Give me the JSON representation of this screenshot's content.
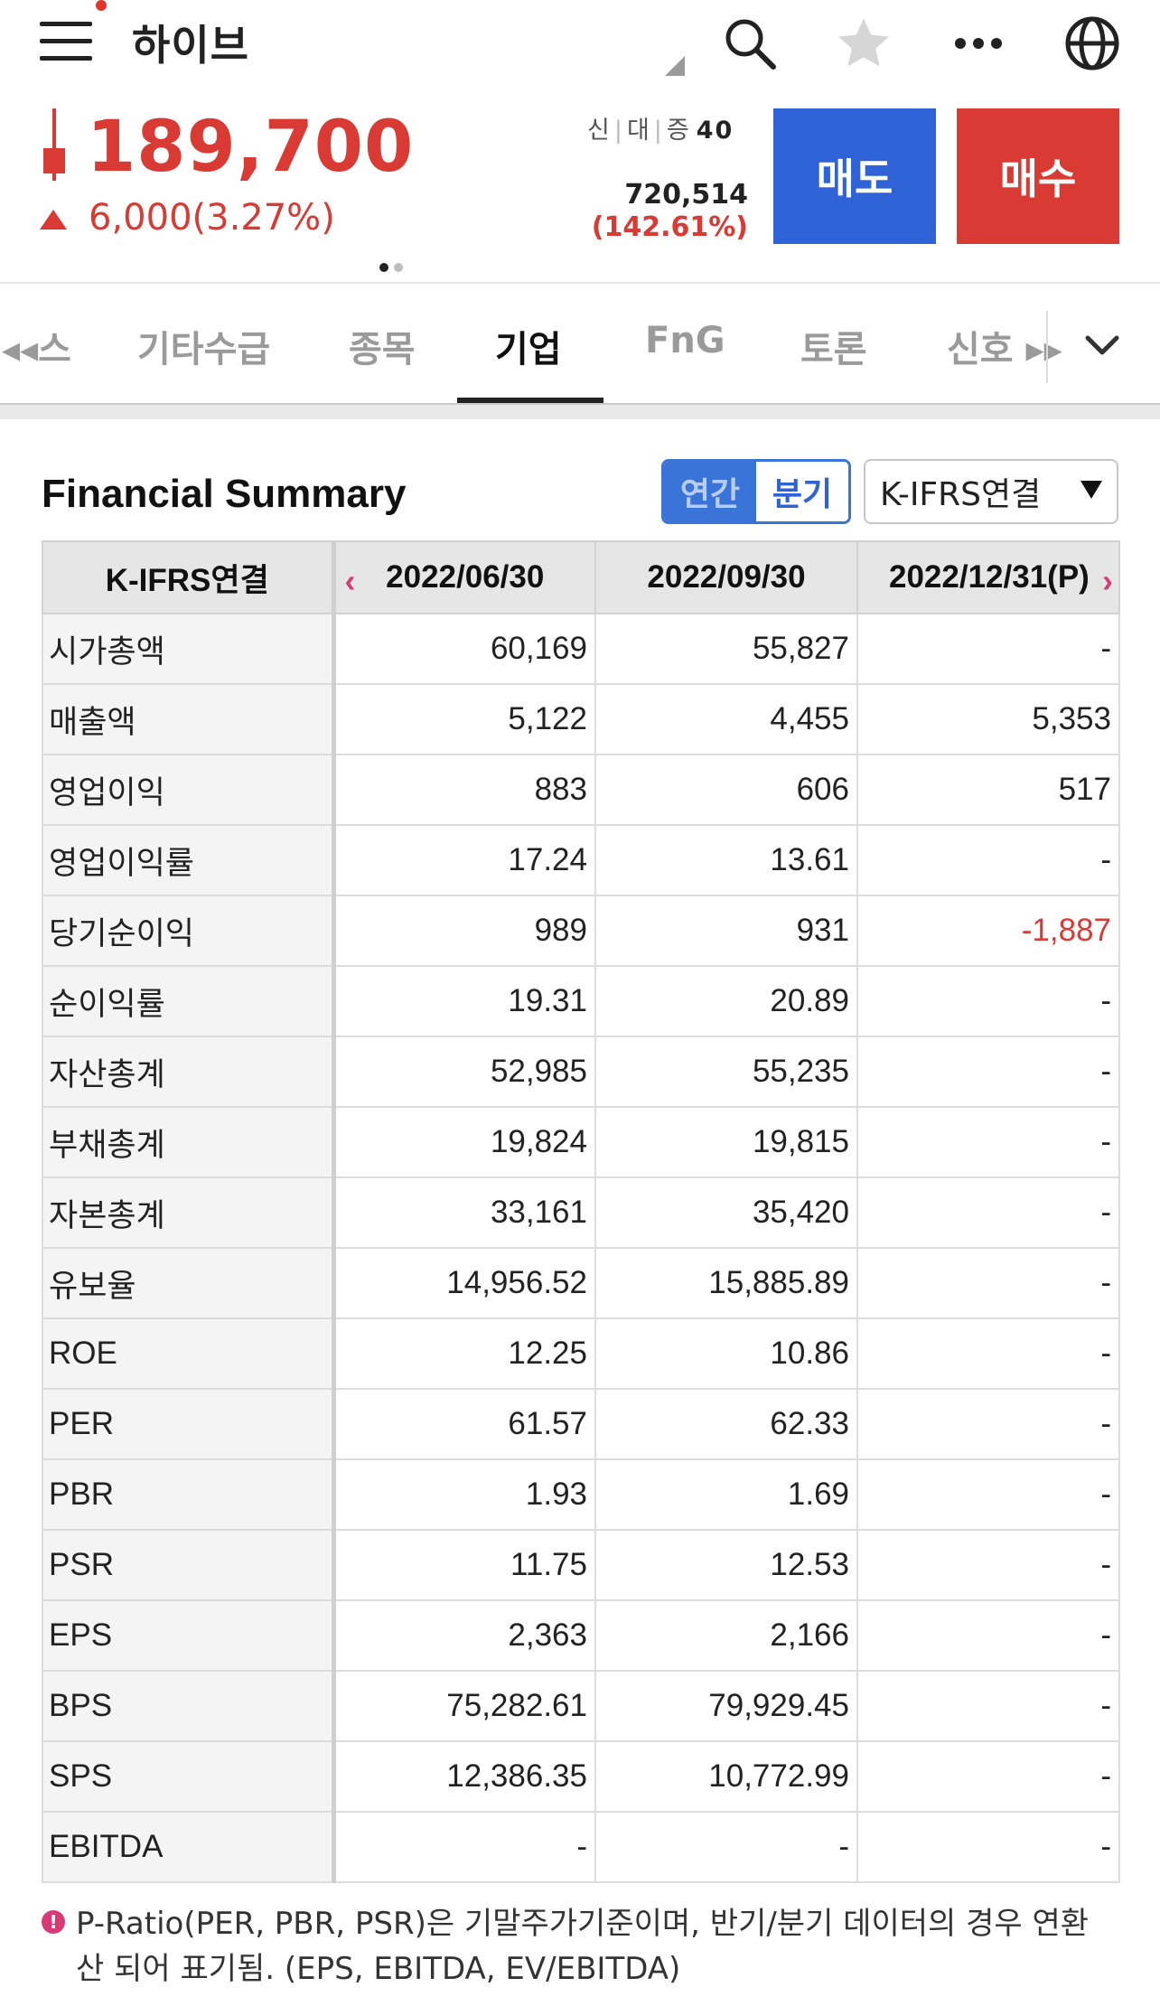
{
  "header": {
    "stock_name": "하이브",
    "icons": [
      "menu-icon",
      "search-icon",
      "star-icon",
      "more-icon",
      "globe-icon"
    ]
  },
  "quote": {
    "price": "189,700",
    "change": "6,000(3.27%)",
    "flags": [
      "신",
      "대",
      "증"
    ],
    "flag_number": "40",
    "volume": "720,514",
    "volume_ratio": "(142.61%)",
    "sell_label": "매도",
    "buy_label": "매수",
    "up_color": "#d93a33",
    "sell_color": "#2e62d6"
  },
  "tabs": [
    {
      "label": "◂◂스",
      "active": false
    },
    {
      "label": "기타수급",
      "active": false
    },
    {
      "label": "종목",
      "active": false
    },
    {
      "label": "기업",
      "active": true
    },
    {
      "label": "FnG",
      "active": false
    },
    {
      "label": "토론",
      "active": false
    },
    {
      "label": "신호 ▸▸",
      "active": false
    }
  ],
  "summary": {
    "title": "Financial Summary",
    "period_toggle": {
      "annual": "연간",
      "quarter": "분기",
      "selected": "분기"
    },
    "standard_select": "K-IFRS연결",
    "columns": [
      "K-IFRS연결",
      "2022/06/30",
      "2022/09/30",
      "2022/12/31(P)"
    ],
    "rows": [
      {
        "label": "시가총액",
        "values": [
          "60,169",
          "55,827",
          "-"
        ]
      },
      {
        "label": "매출액",
        "values": [
          "5,122",
          "4,455",
          "5,353"
        ]
      },
      {
        "label": "영업이익",
        "values": [
          "883",
          "606",
          "517"
        ]
      },
      {
        "label": "영업이익률",
        "values": [
          "17.24",
          "13.61",
          "-"
        ]
      },
      {
        "label": "당기순이익",
        "values": [
          "989",
          "931",
          "-1,887"
        ]
      },
      {
        "label": "순이익률",
        "values": [
          "19.31",
          "20.89",
          "-"
        ]
      },
      {
        "label": "자산총계",
        "values": [
          "52,985",
          "55,235",
          "-"
        ]
      },
      {
        "label": "부채총계",
        "values": [
          "19,824",
          "19,815",
          "-"
        ]
      },
      {
        "label": "자본총계",
        "values": [
          "33,161",
          "35,420",
          "-"
        ]
      },
      {
        "label": "유보율",
        "values": [
          "14,956.52",
          "15,885.89",
          "-"
        ]
      },
      {
        "label": "ROE",
        "values": [
          "12.25",
          "10.86",
          "-"
        ]
      },
      {
        "label": "PER",
        "values": [
          "61.57",
          "62.33",
          "-"
        ]
      },
      {
        "label": "PBR",
        "values": [
          "1.93",
          "1.69",
          "-"
        ]
      },
      {
        "label": "PSR",
        "values": [
          "11.75",
          "12.53",
          "-"
        ]
      },
      {
        "label": "EPS",
        "values": [
          "2,363",
          "2,166",
          "-"
        ]
      },
      {
        "label": "BPS",
        "values": [
          "75,282.61",
          "79,929.45",
          "-"
        ]
      },
      {
        "label": "SPS",
        "values": [
          "12,386.35",
          "10,772.99",
          "-"
        ]
      },
      {
        "label": "EBITDA",
        "values": [
          "-",
          "-",
          "-"
        ]
      }
    ],
    "note": "P-Ratio(PER, PBR, PSR)은 기말주가기준이며, 반기/분기 데이터의 경우 연환산 되어 표기됨. (EPS, EBITDA, EV/EBITDA)"
  }
}
